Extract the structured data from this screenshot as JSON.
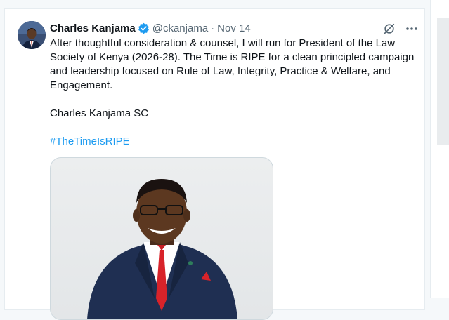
{
  "tweet": {
    "author_name": "Charles Kanjama",
    "handle": "@ckanjama",
    "separator": "·",
    "date": "Nov 14",
    "paragraphs": [
      "After thoughtful consideration & counsel, I will run for President of the Law Society of Kenya (2026-28). The Time is RIPE for a clean principled campaign and leadership focused on Rule of Law, Integrity, Practice & Welfare, and Engagement.",
      "Charles Kanjama SC"
    ],
    "hashtag": "#TheTimeIsRIPE"
  },
  "icons": {
    "verified": "verified-badge-icon",
    "grok": "grok-icon",
    "more": "more-options-icon"
  },
  "colors": {
    "accent": "#1d9bf0",
    "text_primary": "#0f1419",
    "text_secondary": "#536471"
  }
}
